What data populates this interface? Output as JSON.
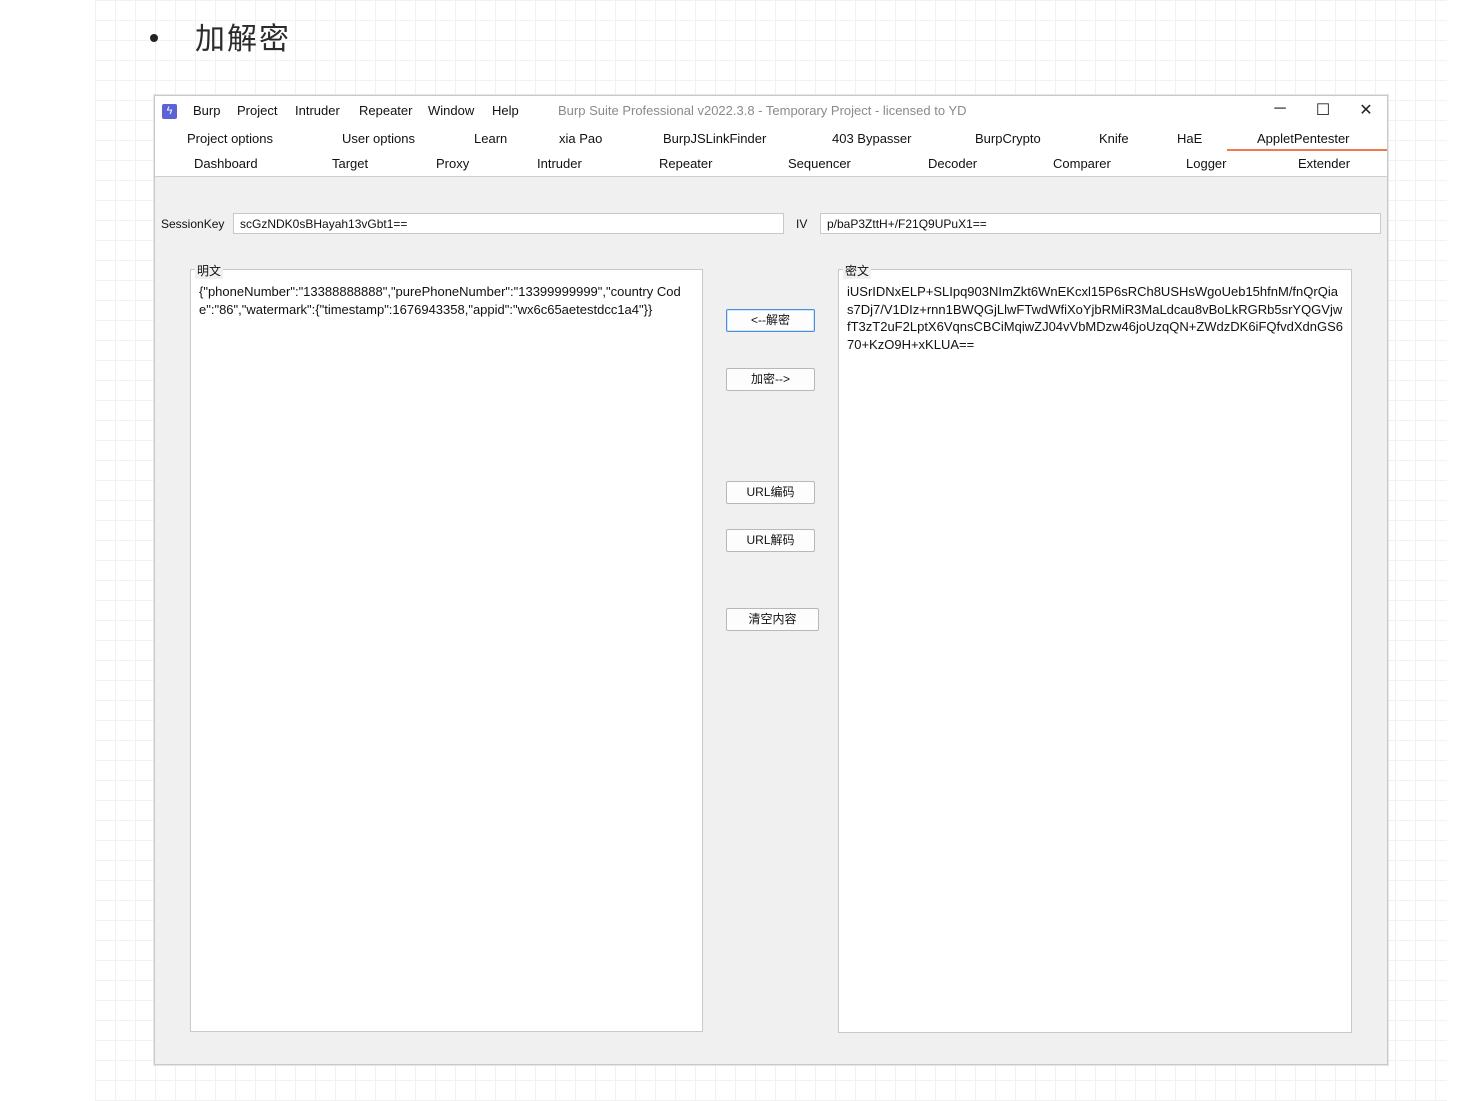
{
  "doc": {
    "heading": "加解密"
  },
  "window": {
    "title": "Burp Suite Professional v2022.3.8 - Temporary Project - licensed to YD",
    "app_icon": "burp-lightning-icon",
    "menu": [
      "Burp",
      "Project",
      "Intruder",
      "Repeater",
      "Window",
      "Help"
    ],
    "controls": {
      "minimize": "─",
      "maximize": "☐",
      "close": "✕"
    }
  },
  "tabs_row1": [
    "Project options",
    "User options",
    "Learn",
    "xia Pao",
    "BurpJSLinkFinder",
    "403 Bypasser",
    "BurpCrypto",
    "Knife",
    "HaE",
    "AppletPentester"
  ],
  "tabs_row2": [
    "Dashboard",
    "Target",
    "Proxy",
    "Intruder",
    "Repeater",
    "Sequencer",
    "Decoder",
    "Comparer",
    "Logger",
    "Extender"
  ],
  "active_tab": "AppletPentester",
  "form": {
    "session_key_label": "SessionKey",
    "session_key_value": "scGzNDK0sBHayah13vGbt1==",
    "iv_label": "IV",
    "iv_value": "p/baP3ZttH+/F21Q9UPuX1=="
  },
  "plaintext": {
    "label": "明文",
    "value": "{\"phoneNumber\":\"13388888888\",\"purePhoneNumber\":\"13399999999\",\"country Code\":\"86\",\"watermark\":{\"timestamp\":1676943358,\"appid\":\"wx6c65aetestdcc1a4\"}}"
  },
  "ciphertext": {
    "label": "密文",
    "value": "iUSrIDNxELP+SLIpq903NImZkt6WnEKcxl15P6sRCh8USHsWgoUeb15hfnM/fnQrQias7Dj7/V1DIz+rnn1BWQGjLlwFTwdWfiXoYjbRMiR3MaLdcau8vBoLkRGRb5srYQGVjwfT3zT2uF2LptX6VqnsCBCiMqiwZJ04vVbMDzw46joUzqQN+ZWdzDK6iFQfvdXdnGS670+KzO9H+xKLUA=="
  },
  "buttons": {
    "decrypt": "<--解密",
    "encrypt": "加密-->",
    "url_encode": "URL编码",
    "url_decode": "URL解码",
    "clear": "清空内容"
  }
}
